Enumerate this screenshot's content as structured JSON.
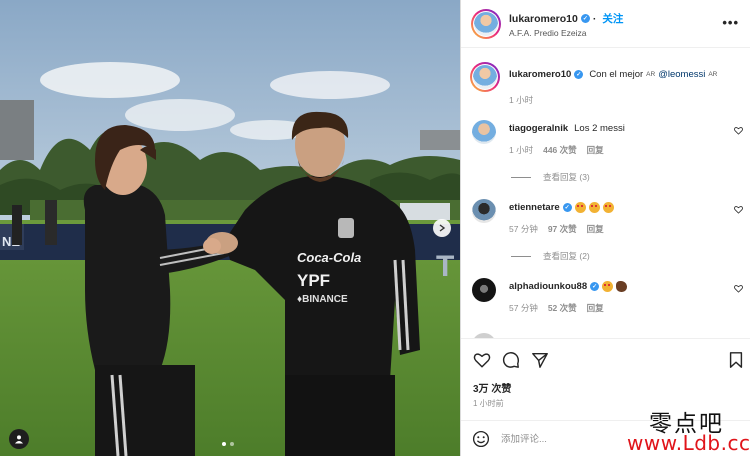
{
  "post": {
    "username": "lukaromero10",
    "follow_label": "关注",
    "location": "A.F.A. Predio Ezeiza",
    "more_label": "•••"
  },
  "caption": {
    "username": "lukaromero10",
    "text": "Con el mejor",
    "flag": "AR",
    "mention": "@leomessi",
    "mention_flag": "AR",
    "time": "1 小时"
  },
  "comments": [
    {
      "username": "tiagogeralnik",
      "text": "Los 2 messi",
      "time": "1 小时",
      "likes": "446 次赞",
      "reply": "回复",
      "view_replies": "查看回复 (3)"
    },
    {
      "username": "etiennetare",
      "text": "",
      "emojis": [
        "star",
        "star",
        "star"
      ],
      "time": "57 分钟",
      "likes": "97 次赞",
      "reply": "回复",
      "view_replies": "查看回复 (2)"
    },
    {
      "username": "alphadiounkou88",
      "text": "",
      "emojis": [
        "star",
        "clap"
      ],
      "time": "57 分钟",
      "likes": "52 次赞",
      "reply": "回复"
    }
  ],
  "stats": {
    "likes": "3万 次赞",
    "time": "1 小时前"
  },
  "comment_input": {
    "placeholder": "添加评论..."
  },
  "carousel": {
    "count": 2,
    "active_index": 0
  },
  "watermark": {
    "cn": "零点吧",
    "url": "www.Ldb.cc"
  },
  "colors": {
    "link_blue": "#0095f6",
    "verified": "#3897f0",
    "watermark_red": "#e0141a"
  }
}
